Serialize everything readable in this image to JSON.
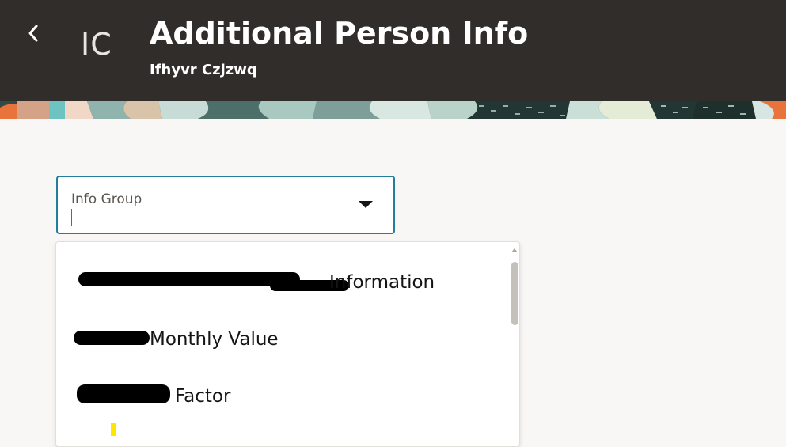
{
  "header": {
    "back_label": "Back",
    "avatar_initials": "IC",
    "title": "Additional Person Info",
    "person_name": "Ifhyvr Czjzwq",
    "background_color": "#312d2a"
  },
  "info_group_select": {
    "label": "Info Group",
    "value": "",
    "border_color": "#227e9e"
  },
  "dropdown": {
    "options": [
      {
        "visible_text": "Information"
      },
      {
        "visible_text": "Monthly Value"
      },
      {
        "visible_text": "Factor"
      }
    ]
  },
  "icons": {
    "back": "chevron-left-icon",
    "dropdown": "triangle-down-icon"
  }
}
